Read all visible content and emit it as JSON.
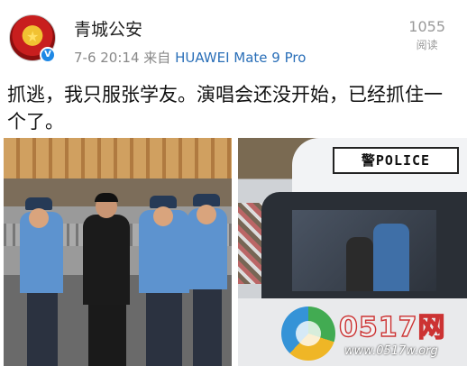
{
  "account": {
    "name": "青城公安",
    "verified_badge": "V"
  },
  "post_meta": {
    "date": "7-6 20:14",
    "from_label": "来自",
    "device": "HUAWEI Mate 9 Pro"
  },
  "reads": {
    "count": "1055",
    "label": "阅读"
  },
  "post": {
    "text": "抓逃，我只服张学友。演唱会还没开始，已经抓住一个了。"
  },
  "photos": {
    "van_sign": "警POLICE"
  },
  "watermark": {
    "brand": "0517网",
    "url": "www.0517w.org"
  },
  "icons": {
    "avatar": "police-emblem-icon",
    "verified": "verified-badge-icon"
  },
  "colors": {
    "device_link": "#2a6fb8",
    "verified_blue": "#1e88e5",
    "meta_gray": "#888888"
  }
}
